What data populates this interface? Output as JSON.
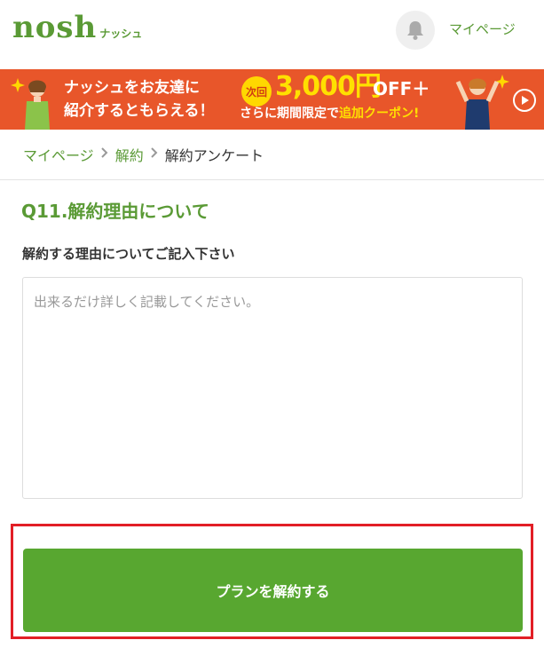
{
  "header": {
    "logo_main": "nosh",
    "logo_sub": "ナッシュ",
    "mypage_label": "マイページ"
  },
  "banner": {
    "left_line1": "ナッシュをお友達に",
    "left_line2": "紹介するともらえる！",
    "badge": "次回",
    "amount": "3,000円",
    "amount_suffix": "OFF＋",
    "sub_prefix": "さらに期間限定で",
    "sub_highlight": "追加クーポン!"
  },
  "breadcrumb": {
    "items": [
      "マイページ",
      "解約"
    ],
    "current": "解約アンケート"
  },
  "question": {
    "title": "Q11.解約理由について",
    "label": "解約する理由についてご記入下さい",
    "placeholder": "出来るだけ詳しく記載してください。",
    "value": ""
  },
  "submit": {
    "label": "プランを解約する"
  },
  "colors": {
    "brand_green": "#5a9a35",
    "button_green": "#58a730",
    "banner_orange": "#e8562a",
    "highlight_red": "#e21f26"
  },
  "icons": {
    "bell": "bell-icon",
    "play": "play-icon",
    "chevron": "chevron-right-icon"
  }
}
